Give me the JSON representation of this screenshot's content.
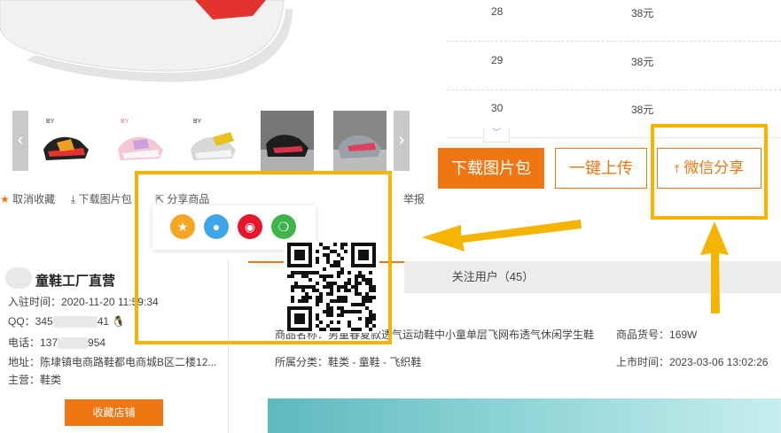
{
  "size_table": {
    "rows": [
      {
        "size": "28",
        "price": "38元"
      },
      {
        "size": "29",
        "price": "38元"
      },
      {
        "size": "30",
        "price": "38元"
      }
    ],
    "expand_icon": "chevron-down-icon"
  },
  "thumbnails": {
    "prev_icon": "chevron-left-icon",
    "next_icon": "chevron-right-icon",
    "count": 5
  },
  "actions": {
    "download_label": "下载图片包",
    "upload_label": "一键上传",
    "wechat_label": "微信分享",
    "wechat_icon": "share-up-icon"
  },
  "toolbar": {
    "unfavorite_label": "取消收藏",
    "download_pics_label": "下载图片包",
    "share_label": "分享商品",
    "report_label": "举报"
  },
  "share_popup": {
    "icons": [
      "qzone-icon",
      "qq-icon",
      "weibo-icon",
      "wechat-icon"
    ]
  },
  "store": {
    "name": "童鞋工厂直营",
    "join_label": "入驻时间：",
    "join_value": "2020-11-20 11:59:34",
    "qq_label": "QQ：",
    "qq_prefix": "345",
    "qq_suffix": "41",
    "phone_label": "电话：",
    "phone_prefix": "137",
    "phone_suffix": "954",
    "address_label": "地址：",
    "address_value": "陈埭镇电商路鞋都电商城B区二楼12...",
    "main_label": "主营：",
    "main_value": "鞋类",
    "favorite_button": "收藏店铺"
  },
  "tabs": {
    "follow_label": "关注用户（45）"
  },
  "product": {
    "name_label": "商品名称：",
    "name_value": "男童春夏款透气运动鞋中小童单层飞网布透气休闲学生鞋",
    "code_label": "商品货号：",
    "code_value": "169W",
    "category_label": "所属分类：",
    "category_value": "鞋类 - 童鞋 - 飞织鞋",
    "date_label": "上市时间：",
    "date_value": "2023-03-06 13:02:26"
  },
  "colors": {
    "accent": "#f07613",
    "annotation": "#f5b400",
    "qzone": "#f5a623",
    "qq": "#3ea6e6",
    "weibo": "#e6162d",
    "wechat": "#3fb44b"
  }
}
